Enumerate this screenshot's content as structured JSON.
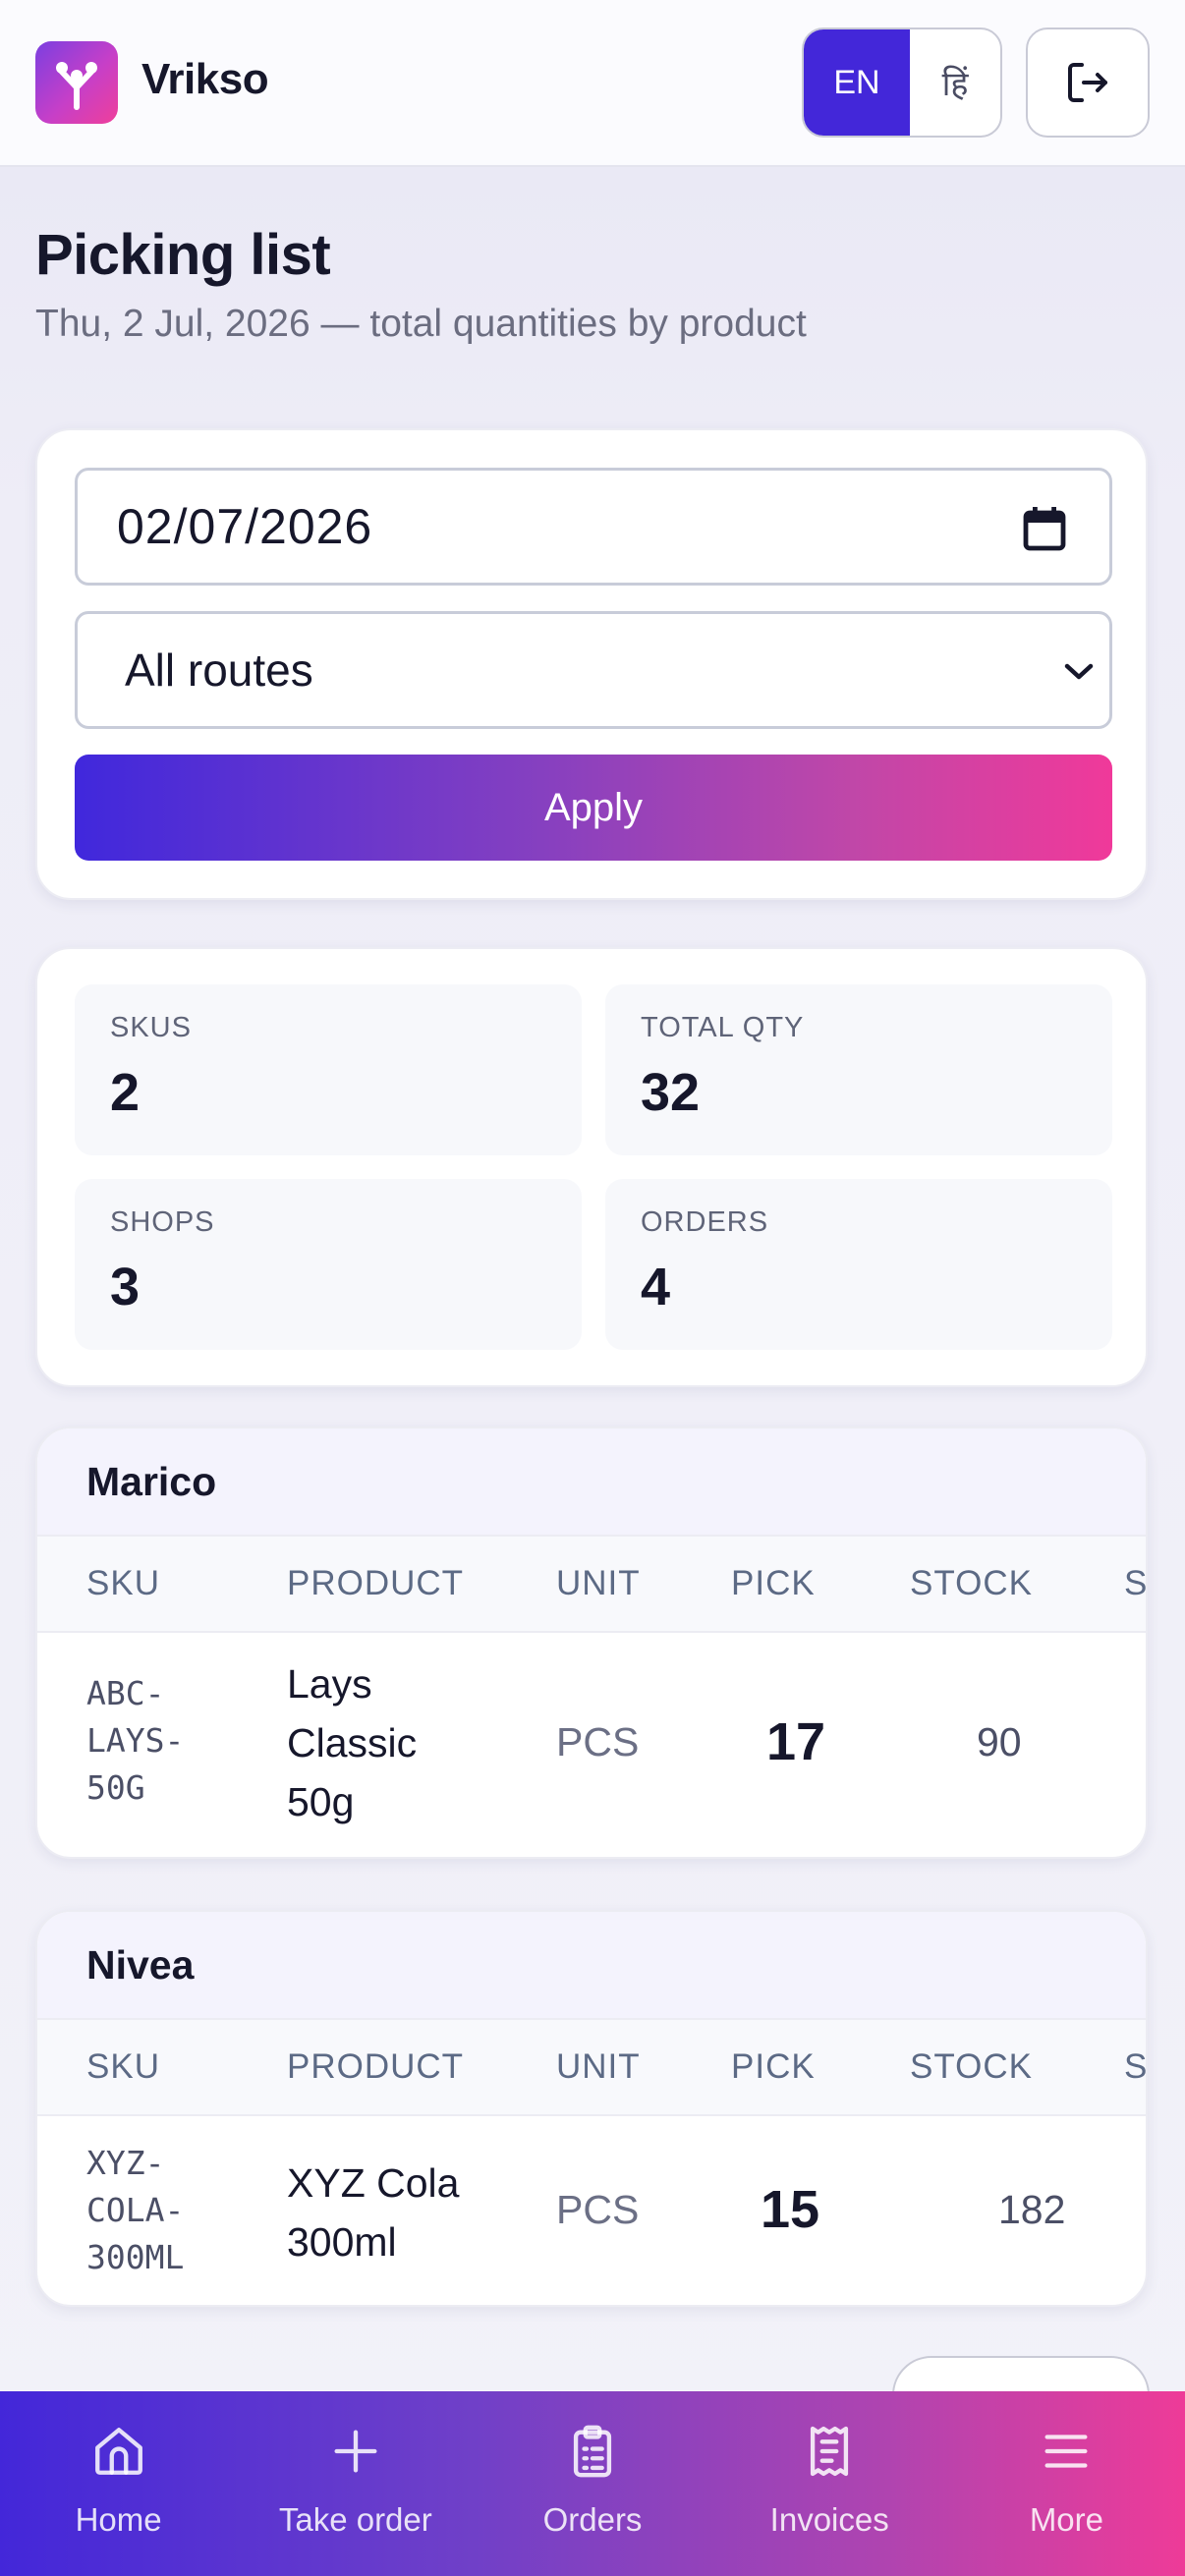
{
  "app": {
    "name": "Vrikso"
  },
  "header": {
    "lang_en": "EN",
    "lang_hi": "हिं"
  },
  "page": {
    "title": "Picking list",
    "subtitle": "Thu, 2 Jul, 2026 — total quantities by product"
  },
  "filters": {
    "date_value": "02/07/2026",
    "route_value": "All routes",
    "apply_label": "Apply"
  },
  "stats": [
    {
      "label": "SKUS",
      "value": "2"
    },
    {
      "label": "TOTAL QTY",
      "value": "32"
    },
    {
      "label": "SHOPS",
      "value": "3"
    },
    {
      "label": "ORDERS",
      "value": "4"
    }
  ],
  "columns": {
    "sku": "SKU",
    "product": "PRODUCT",
    "unit": "UNIT",
    "pick": "PICK",
    "stock": "STOCK",
    "more": "S"
  },
  "groups": [
    {
      "brand": "Marico",
      "rows": [
        {
          "sku_lines": [
            "ABC-",
            "LAYS-",
            "50G"
          ],
          "product_lines": [
            "Lays",
            "Classic",
            "50g"
          ],
          "unit": "PCS",
          "pick": "17",
          "stock": "90"
        }
      ]
    },
    {
      "brand": "Nivea",
      "rows": [
        {
          "sku_lines": [
            "XYZ-",
            "COLA-",
            "300ML"
          ],
          "product_lines": [
            "XYZ Cola",
            "300ml"
          ],
          "unit": "PCS",
          "pick": "15",
          "stock": "182"
        }
      ]
    }
  ],
  "nav": [
    {
      "label": "Home",
      "icon": "home-icon"
    },
    {
      "label": "Take order",
      "icon": "plus-icon"
    },
    {
      "label": "Orders",
      "icon": "clipboard-icon"
    },
    {
      "label": "Invoices",
      "icon": "receipt-icon"
    },
    {
      "label": "More",
      "icon": "menu-icon"
    }
  ],
  "colors": {
    "accent": "#4327d9",
    "accent_end": "#ee3b98"
  }
}
